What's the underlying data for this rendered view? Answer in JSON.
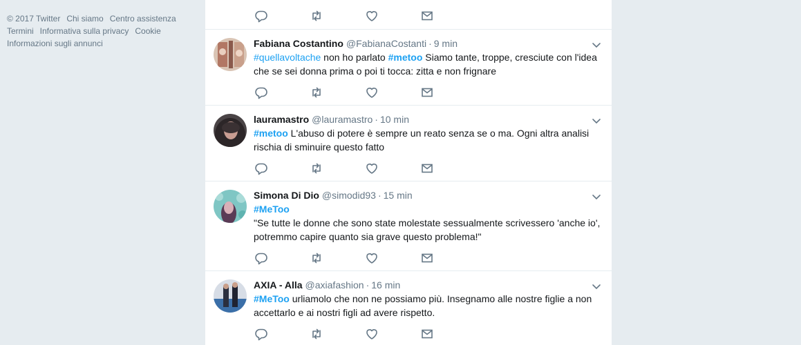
{
  "footer": {
    "links": [
      "© 2017 Twitter",
      "Chi siamo",
      "Centro assistenza",
      "Termini",
      "Informativa sulla privacy",
      "Cookie",
      "Informazioni sugli annunci"
    ]
  },
  "tweets": [
    {
      "fullname": "Fabiana Costantino",
      "screen_name": "@FabianaCostanti",
      "separator": "·",
      "time": "9 min",
      "line1_hashtag1": "#quellavoltache",
      "line1_text1": " non ho parlato ",
      "line1_hashtag2": "#metoo",
      "line1_text2": " Siamo tante, troppe, cresciute con l'idea",
      "line2": "che se sei donna prima o poi ti tocca: zitta e non frignare"
    },
    {
      "fullname": "lauramastro",
      "screen_name": "@lauramastro",
      "separator": "·",
      "time": "10 min",
      "line1_hashtag": "#metoo",
      "line1_text": " L'abuso di potere è sempre un reato senza se o ma. Ogni altra analisi",
      "line2": "rischia di sminuire questo fatto"
    },
    {
      "fullname": "Simona Di Dio",
      "screen_name": "@simodid93",
      "separator": "·",
      "time": "15 min",
      "line1_hashtag": "#MeToo",
      "line2": "\"Se tutte le donne che sono state molestate sessualmente scrivessero 'anche io',",
      "line3": "potremmo capire quanto sia grave questo problema!\""
    },
    {
      "fullname": "AXIA - Alla",
      "screen_name": "@axiafashion",
      "separator": "·",
      "time": "16 min",
      "line1_hashtag": "#MeToo",
      "line1_text": " urliamolo che non ne possiamo più. Insegnamo alle nostre figlie a non",
      "line2": "accettarlo e ai nostri figli ad avere rispetto."
    }
  ],
  "colors": {
    "background": "#e6ecf0",
    "hashtag": "#1da1f2",
    "text": "#14171a",
    "secondary": "#657786"
  }
}
